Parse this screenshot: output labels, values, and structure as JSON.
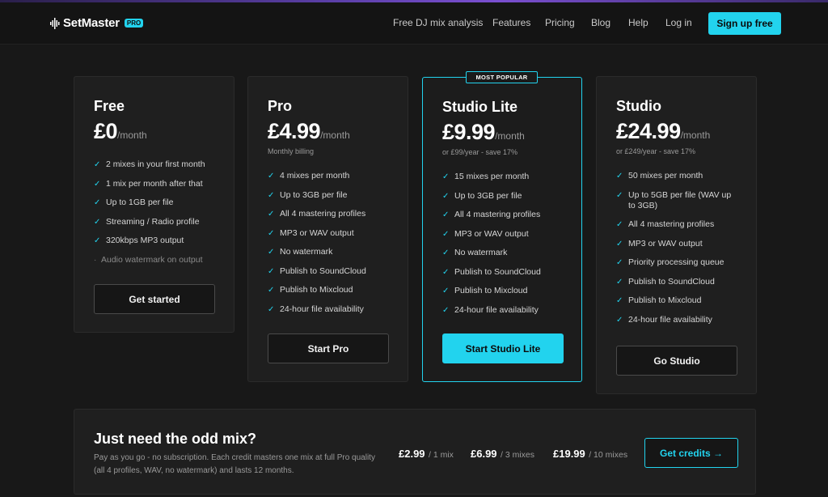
{
  "nav": {
    "brand": "SetMaster",
    "brand_badge": "PRO",
    "links": [
      "Free DJ mix analysis",
      "Features",
      "Pricing",
      "Blog",
      "Help",
      "Log in"
    ],
    "signup_label": "Sign up free"
  },
  "accent_color": "#22d3ee",
  "icons": {
    "feature_check": "check-icon",
    "feature_bullet": "bullet-icon",
    "logo": "waveform-icon"
  },
  "plans": [
    {
      "name": "Free",
      "price": "£0",
      "period": "/month",
      "billing": "",
      "features": [
        {
          "text": "2 mixes in your first month",
          "included": true
        },
        {
          "text": "1 mix per month after that",
          "included": true
        },
        {
          "text": "Up to 1GB per file",
          "included": true
        },
        {
          "text": "Streaming / Radio profile",
          "included": true
        },
        {
          "text": "320kbps MP3 output",
          "included": true
        },
        {
          "text": "Audio watermark on output",
          "included": false
        }
      ],
      "cta": "Get started"
    },
    {
      "name": "Pro",
      "price": "£4.99",
      "period": "/month",
      "billing": "Monthly billing",
      "features": [
        {
          "text": "4 mixes per month",
          "included": true
        },
        {
          "text": "Up to 3GB per file",
          "included": true
        },
        {
          "text": "All 4 mastering profiles",
          "included": true
        },
        {
          "text": "MP3 or WAV output",
          "included": true
        },
        {
          "text": "No watermark",
          "included": true
        },
        {
          "text": "Publish to SoundCloud",
          "included": true
        },
        {
          "text": "Publish to Mixcloud",
          "included": true
        },
        {
          "text": "24-hour file availability",
          "included": true
        }
      ],
      "cta": "Start Pro"
    },
    {
      "name": "Studio Lite",
      "badge": "MOST POPULAR",
      "price": "£9.99",
      "period": "/month",
      "billing": "or £99/year - save 17%",
      "features": [
        {
          "text": "15 mixes per month",
          "included": true
        },
        {
          "text": "Up to 3GB per file",
          "included": true
        },
        {
          "text": "All 4 mastering profiles",
          "included": true
        },
        {
          "text": "MP3 or WAV output",
          "included": true
        },
        {
          "text": "No watermark",
          "included": true
        },
        {
          "text": "Publish to SoundCloud",
          "included": true
        },
        {
          "text": "Publish to Mixcloud",
          "included": true
        },
        {
          "text": "24-hour file availability",
          "included": true
        }
      ],
      "cta": "Start Studio Lite"
    },
    {
      "name": "Studio",
      "price": "£24.99",
      "period": "/month",
      "billing": "or £249/year - save 17%",
      "features": [
        {
          "text": "50 mixes per month",
          "included": true
        },
        {
          "text": "Up to 5GB per file (WAV up to 3GB)",
          "included": true
        },
        {
          "text": "All 4 mastering profiles",
          "included": true
        },
        {
          "text": "MP3 or WAV output",
          "included": true
        },
        {
          "text": "Priority processing queue",
          "included": true
        },
        {
          "text": "Publish to SoundCloud",
          "included": true
        },
        {
          "text": "Publish to Mixcloud",
          "included": true
        },
        {
          "text": "24-hour file availability",
          "included": true
        }
      ],
      "cta": "Go Studio"
    }
  ],
  "credits": {
    "title": "Just need the odd mix?",
    "description": "Pay as you go - no subscription. Each credit masters one mix at full Pro quality (all 4 profiles, WAV, no watermark) and lasts 12 months.",
    "bundles": [
      {
        "price": "£2.99",
        "qty": "/ 1 mix"
      },
      {
        "price": "£6.99",
        "qty": "/ 3 mixes"
      },
      {
        "price": "£19.99",
        "qty": "/ 10 mixes"
      }
    ],
    "cta": "Get credits →"
  }
}
